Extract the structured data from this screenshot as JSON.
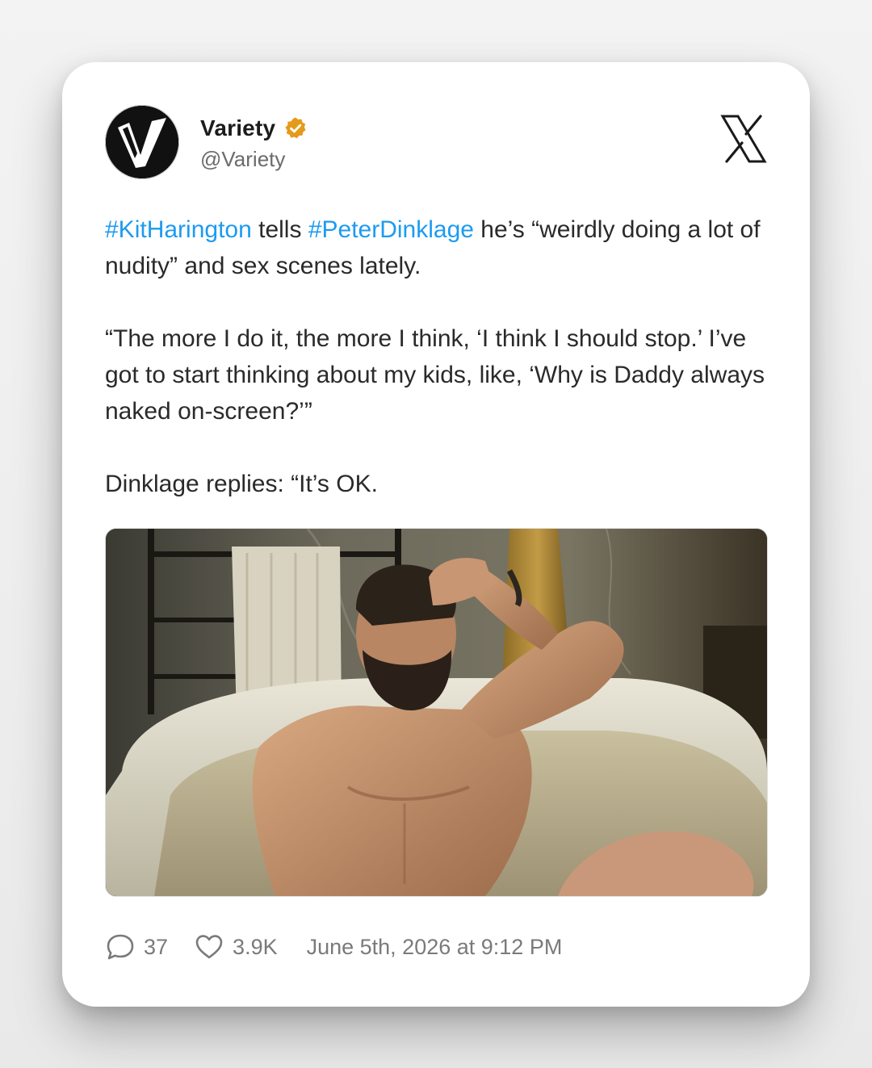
{
  "post": {
    "author": {
      "display_name": "Variety",
      "handle": "@Variety",
      "verified": true,
      "verified_color": "#e49b1a",
      "avatar_icon": "variety-v-logo"
    },
    "platform_icon": "x-logo-icon",
    "text": {
      "line1_hashtag1": "#KitHarington",
      "line1_mid": " tells ",
      "line1_hashtag2": "#PeterDinklage",
      "line1_rest": " he’s “weirdly doing a lot of nudity” and sex scenes lately.",
      "paragraph2": "“The more I do it, the more I think, ‘I think I should stop.’ I’ve got to start thinking about my kids, like, ‘Why is Daddy always naked on-screen?’”",
      "paragraph3": "Dinklage replies: “It’s OK."
    },
    "media": {
      "type": "photo"
    },
    "stats": {
      "replies": "37",
      "likes": "3.9K",
      "timestamp": "June 5th, 2026 at 9:12 PM"
    },
    "colors": {
      "hashtag": "#1d9bf0",
      "text": "#2a2a2a",
      "muted": "#7a7a7a"
    }
  }
}
